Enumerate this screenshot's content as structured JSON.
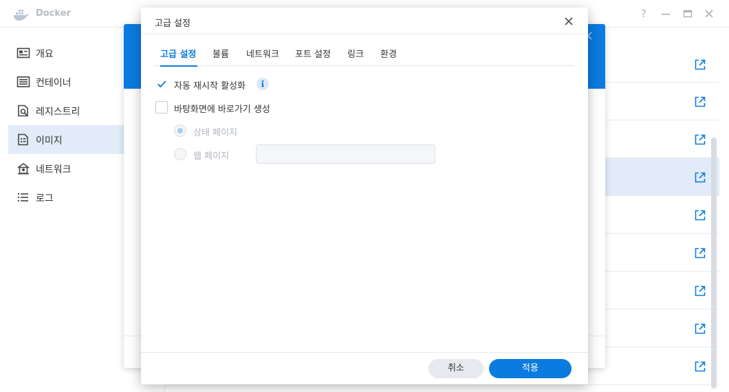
{
  "window": {
    "title": "Docker",
    "controls": [
      "help-icon",
      "minimize-icon",
      "maximize-icon",
      "close-icon"
    ]
  },
  "sidebar": {
    "items": [
      {
        "label": "개요",
        "icon": "overview-icon"
      },
      {
        "label": "컨테이너",
        "icon": "container-icon"
      },
      {
        "label": "레지스트리",
        "icon": "registry-icon"
      },
      {
        "label": "이미지",
        "icon": "image-icon",
        "active": true
      },
      {
        "label": "네트워크",
        "icon": "network-icon"
      },
      {
        "label": "로그",
        "icon": "log-icon"
      }
    ]
  },
  "dialog": {
    "title": "고급 설정",
    "tabs": [
      {
        "label": "고급 설정",
        "active": true
      },
      {
        "label": "볼륨"
      },
      {
        "label": "네트워크"
      },
      {
        "label": "포트 설정"
      },
      {
        "label": "링크"
      },
      {
        "label": "환경"
      }
    ],
    "options": {
      "auto_restart": {
        "label": "자동 재시작 활성화",
        "checked": true
      },
      "desktop_shortcut": {
        "label": "바탕화면에 바로가기 생성",
        "checked": false
      },
      "status_page": {
        "label": "상태 페이지",
        "selected": true,
        "disabled": true
      },
      "web_page": {
        "label": "웹 페이지",
        "selected": false,
        "disabled": true,
        "value": ""
      }
    },
    "buttons": {
      "cancel": "취소",
      "apply": "적용"
    }
  },
  "colors": {
    "accent": "#0b7bdf",
    "selection": "#e1ecf8",
    "divider": "#e6e9ee"
  }
}
